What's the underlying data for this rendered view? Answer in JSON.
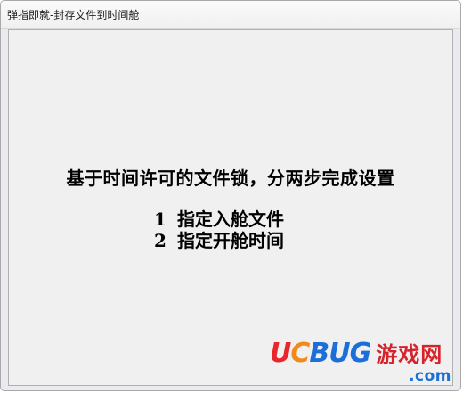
{
  "window": {
    "title": "弹指即就-封存文件到时间舱"
  },
  "main": {
    "headline": "基于时间许可的文件锁，分两步完成设置",
    "steps": [
      {
        "number": "1",
        "text": "指定入舱文件"
      },
      {
        "number": "2",
        "text": "指定开舱时间"
      }
    ]
  },
  "watermark": {
    "letter_u": "U",
    "letter_c": "C",
    "letters_bug": "BUG",
    "chinese": "游戏网",
    "domain": ".com"
  },
  "colors": {
    "window_background": "#f0f0f0",
    "title_text": "#222222",
    "watermark_red": "#e8272c",
    "watermark_orange": "#f08a1c",
    "watermark_blue": "#1c6fd6"
  }
}
